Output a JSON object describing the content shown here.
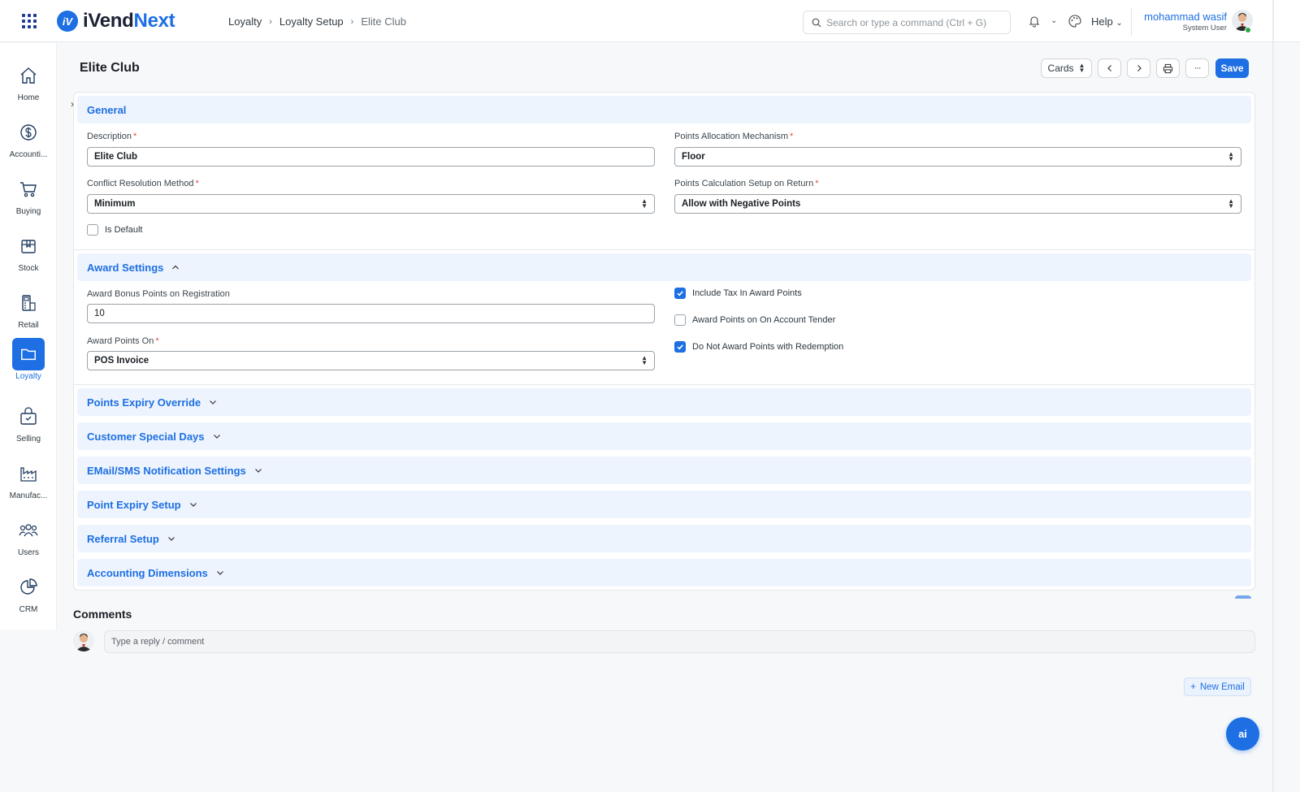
{
  "app": {
    "logo_prefix": "iVend",
    "logo_suffix": "Next",
    "logo_mark": "iV"
  },
  "breadcrumb": [
    "Loyalty",
    "Loyalty Setup",
    "Elite Club"
  ],
  "search": {
    "placeholder": "Search or type a command (Ctrl + G)"
  },
  "topbar": {
    "help_label": "Help",
    "user_name": "mohammad wasif",
    "user_role": "System User"
  },
  "sidebar": {
    "items": [
      {
        "label": "Home",
        "icon": "home-icon"
      },
      {
        "label": "Accounti...",
        "icon": "dollar-icon"
      },
      {
        "label": "Buying",
        "icon": "cart-icon"
      },
      {
        "label": "Stock",
        "icon": "box-icon"
      },
      {
        "label": "Retail",
        "icon": "retail-icon"
      },
      {
        "label": "Loyalty",
        "icon": "folder-icon",
        "active": true
      },
      {
        "label": "Selling",
        "icon": "shopping-bag-icon"
      },
      {
        "label": "Manufac...",
        "icon": "factory-icon"
      },
      {
        "label": "Users",
        "icon": "users-icon"
      },
      {
        "label": "CRM",
        "icon": "pie-chart-icon"
      }
    ]
  },
  "page": {
    "title": "Elite Club",
    "view_label": "Cards",
    "save_label": "Save",
    "more_label": "···"
  },
  "general": {
    "title": "General",
    "description": {
      "label": "Description",
      "value": "Elite Club"
    },
    "points_allocation": {
      "label": "Points Allocation Mechanism",
      "value": "Floor"
    },
    "conflict_resolution": {
      "label": "Conflict Resolution Method",
      "value": "Minimum"
    },
    "points_calc_return": {
      "label": "Points Calculation Setup on Return",
      "value": "Allow with Negative Points"
    },
    "is_default": {
      "label": "Is Default",
      "checked": false
    }
  },
  "award": {
    "title": "Award Settings",
    "bonus_points": {
      "label": "Award Bonus Points on Registration",
      "value": "10"
    },
    "award_on": {
      "label": "Award Points On",
      "value": "POS Invoice"
    },
    "include_tax": {
      "label": "Include Tax In Award Points",
      "checked": true
    },
    "on_account": {
      "label": "Award Points on On Account Tender",
      "checked": false
    },
    "no_redemption": {
      "label": "Do Not Award Points with Redemption",
      "checked": true
    }
  },
  "sections": [
    "Points Expiry Override",
    "Customer Special Days",
    "EMail/SMS Notification Settings",
    "Point Expiry Setup",
    "Referral Setup",
    "Accounting Dimensions"
  ],
  "comments": {
    "title": "Comments",
    "placeholder": "Type a reply / comment"
  },
  "new_email_label": "New Email",
  "ai_label": "ai",
  "colors": {
    "accent": "#1d6fe3",
    "section_bg": "#eef4fd",
    "required": "#e24c4c"
  }
}
